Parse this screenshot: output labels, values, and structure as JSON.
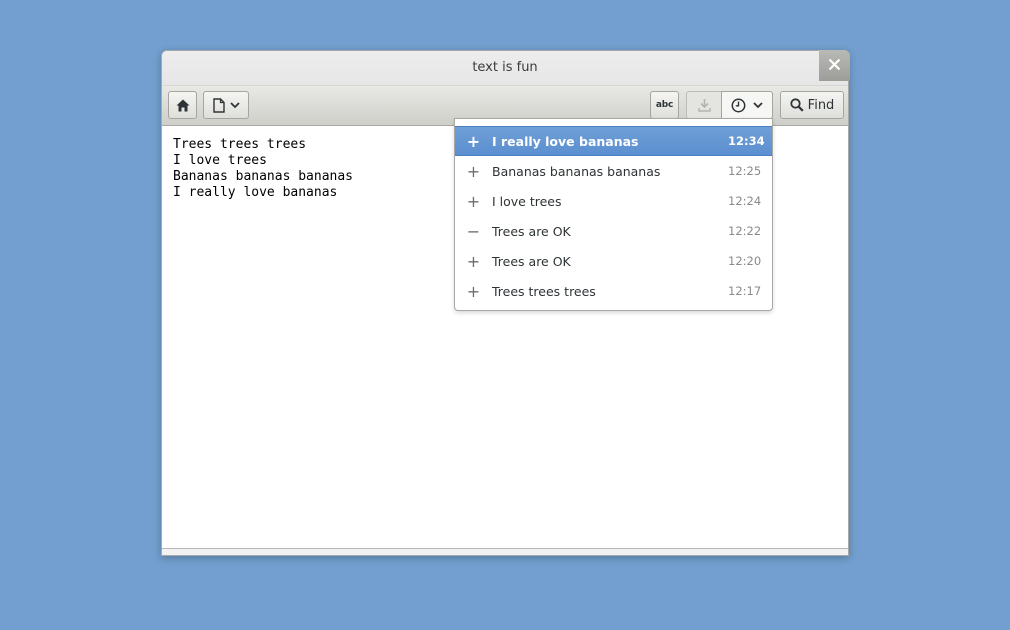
{
  "window": {
    "title": "text is fun"
  },
  "toolbar": {
    "home_icon": "home-icon",
    "document_icon": "document-icon",
    "spell_label": "abc",
    "save_icon": "download-icon",
    "history_icon": "clock-icon",
    "find_label": "Find",
    "find_icon": "search-icon"
  },
  "editor": {
    "lines": [
      "Trees trees trees",
      "I love trees",
      "Bananas bananas bananas",
      "I really love bananas"
    ]
  },
  "history": {
    "items": [
      {
        "sign": "+",
        "text": "I really love bananas",
        "time": "12:34",
        "selected": true
      },
      {
        "sign": "+",
        "text": "Bananas bananas bananas",
        "time": "12:25",
        "selected": false
      },
      {
        "sign": "+",
        "text": "I love trees",
        "time": "12:24",
        "selected": false
      },
      {
        "sign": "−",
        "text": "Trees are OK",
        "time": "12:22",
        "selected": false
      },
      {
        "sign": "+",
        "text": "Trees are OK",
        "time": "12:20",
        "selected": false
      },
      {
        "sign": "+",
        "text": "Trees trees trees",
        "time": "12:17",
        "selected": false
      }
    ]
  },
  "colors": {
    "desktop": "#729fcf",
    "selection": "#5b8fd0"
  }
}
